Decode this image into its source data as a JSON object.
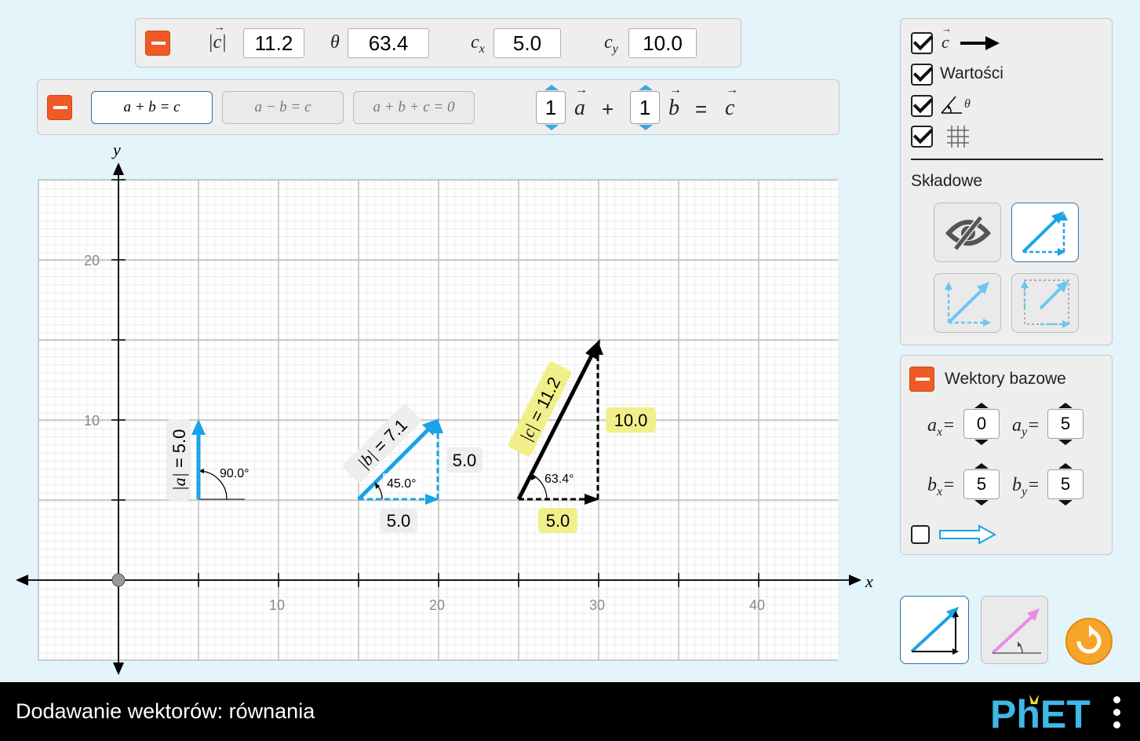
{
  "app": {
    "title": "Dodawanie wektorów: równania",
    "brand": "PhET"
  },
  "sum_panel": {
    "mag_label": "|c|",
    "mag_value": "11.2",
    "theta_label": "θ",
    "theta_value": "63.4",
    "cx_label": "c",
    "cx_sub": "x",
    "cx_value": "5.0",
    "cy_label": "c",
    "cy_sub": "y",
    "cy_value": "10.0"
  },
  "equation_panel": {
    "types": [
      "a + b = c",
      "a − b = c",
      "a + b + c = 0"
    ],
    "selected_type": "a + b = c",
    "coef_a": "1",
    "vec_a": "a",
    "plus": "+",
    "coef_b": "1",
    "vec_b": "b",
    "equals": "=",
    "vec_c": "c"
  },
  "options": {
    "sum_vector_label": "c",
    "values_label": "Wartości",
    "angle_label": "θ",
    "sum_checked": true,
    "values_checked": true,
    "angles_checked": true,
    "grid_checked": true,
    "components_title": "Składowe",
    "component_styles": [
      "invisible",
      "triangle",
      "parallelogram",
      "projection"
    ],
    "selected_component_style": "triangle"
  },
  "base_vectors": {
    "title": "Wektory bazowe",
    "ax_label": "a",
    "ax_sub": "x",
    "ax_value": "0",
    "ay_label": "a",
    "ay_sub": "y",
    "ay_value": "5",
    "bx_label": "b",
    "bx_sub": "x",
    "bx_value": "5",
    "by_label": "b",
    "by_sub": "y",
    "by_value": "5",
    "show_checked": false
  },
  "modes": {
    "selected": "cartesian",
    "options": [
      "cartesian",
      "polar"
    ]
  },
  "graph": {
    "x_axis_label": "x",
    "y_axis_label": "y",
    "x_ticks": [
      "10",
      "20",
      "30",
      "40"
    ],
    "y_ticks": [
      "10",
      "20"
    ],
    "vector_a": {
      "tail": [
        5,
        5
      ],
      "components": [
        0,
        5
      ],
      "magnitude_label": "|a| = 5.0",
      "angle_label": "90.0°"
    },
    "vector_b": {
      "tail": [
        15,
        5
      ],
      "components": [
        5,
        5
      ],
      "magnitude_label": "|b| = 7.1",
      "angle_label": "45.0°",
      "x_component_label": "5.0",
      "y_component_label": "5.0"
    },
    "vector_c": {
      "tail": [
        25,
        5
      ],
      "components": [
        5,
        10
      ],
      "magnitude_label": "|c| = 11.2",
      "angle_label": "63.4°",
      "x_component_label": "5.0",
      "y_component_label": "10.0"
    }
  },
  "colors": {
    "accent_orange": "#f15a24",
    "vector_blue": "#1aa3e8",
    "sum_black": "#000000",
    "highlight_yellow": "#f2ef8a",
    "polar_pink": "#e98ce8"
  }
}
